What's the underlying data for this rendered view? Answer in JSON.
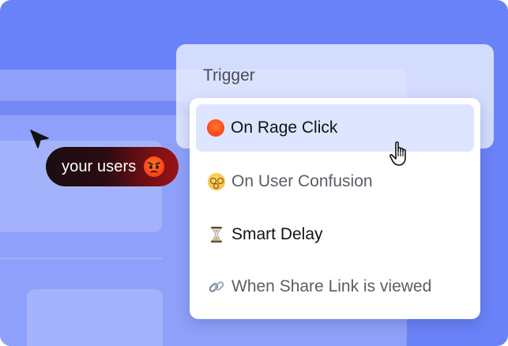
{
  "pill": {
    "text": "your users",
    "emoji": "angry-face-icon"
  },
  "trigger": {
    "label": "Trigger"
  },
  "dropdown": {
    "options": [
      {
        "label": "On Rage Click",
        "icon": "angry-face-icon",
        "state": "hovered"
      },
      {
        "label": "On User Confusion",
        "icon": "dizzy-face-icon",
        "state": "normal"
      },
      {
        "label": "Smart Delay",
        "icon": "hourglass-icon",
        "state": "normal"
      },
      {
        "label": "When Share Link is viewed",
        "icon": "link-icon",
        "state": "normal"
      }
    ]
  },
  "colors": {
    "background": "#6a82f7",
    "hover": "#dde5ff",
    "pill_start": "#1b0d12",
    "pill_end": "#9a1418"
  }
}
